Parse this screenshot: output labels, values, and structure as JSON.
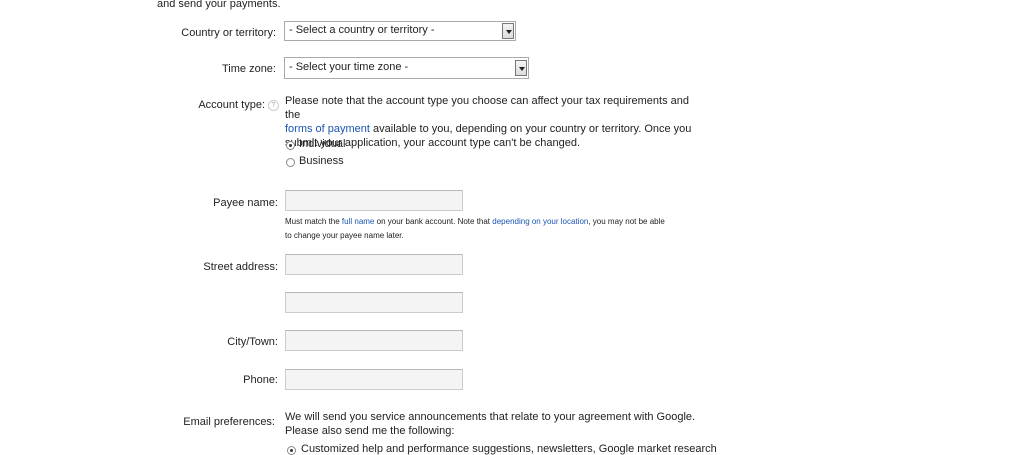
{
  "intro_tail": "and send your payments.",
  "country": {
    "label": "Country or territory:",
    "value": "- Select a country or territory -"
  },
  "timezone": {
    "label": "Time zone:",
    "value": "- Select your time zone -"
  },
  "account_type": {
    "label": "Account type:",
    "help": "?",
    "note_part1": "Please note that the account type you choose can affect your tax requirements and the",
    "note_link": "forms of payment",
    "note_part2": "available to you, depending on your country or territory. Once you",
    "note_part3": "submit your application, your account type can't be changed.",
    "options": [
      {
        "label": "Individual",
        "selected": true
      },
      {
        "label": "Business",
        "selected": false
      }
    ]
  },
  "payee": {
    "label": "Payee name:",
    "value": "",
    "hint_a": "Must match the",
    "hint_link1": "full name",
    "hint_b": "on your bank account. Note that",
    "hint_link2": "depending on your location",
    "hint_c": ", you may not be able",
    "hint_d": "to change your payee name later."
  },
  "street": {
    "label": "Street address:",
    "line1": "",
    "line2": ""
  },
  "city": {
    "label": "City/Town:",
    "value": ""
  },
  "phone": {
    "label": "Phone:",
    "value": ""
  },
  "email_prefs": {
    "label": "Email preferences:",
    "line1": "We will send you service announcements that relate to your agreement with Google.",
    "line2": "Please also send me the following:",
    "option1": "Customized help and performance suggestions, newsletters, Google market research"
  },
  "colors": {
    "link": "#1a55b2",
    "input_bg": "#f4f4f4",
    "input_border": "#cccccc"
  }
}
